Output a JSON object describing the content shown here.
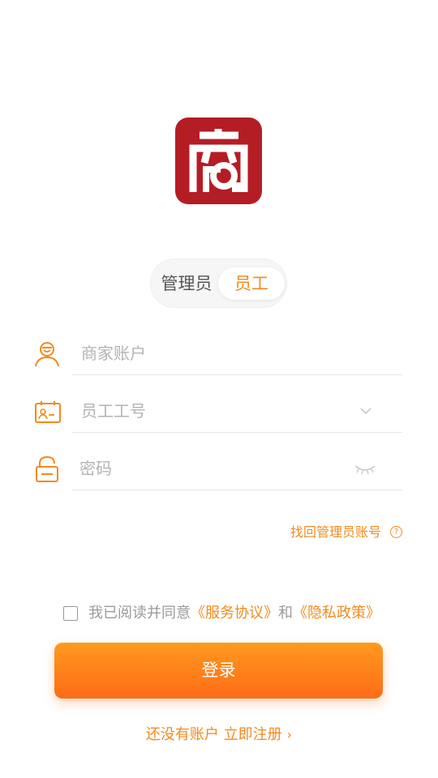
{
  "brand": {
    "logo_char": "商",
    "logo_bg": "#b51d25"
  },
  "role_switch": {
    "admin_label": "管理员",
    "staff_label": "员工",
    "selected": "员工"
  },
  "form": {
    "account": {
      "placeholder": "商家账户",
      "value": "",
      "icon": "user-icon"
    },
    "staff_no": {
      "placeholder": "员工工号",
      "value": "",
      "icon": "id-card-icon",
      "dropdown_icon": "chevron-down-icon"
    },
    "password": {
      "placeholder": "密码",
      "value": "",
      "icon": "lock-icon",
      "toggle_icon": "eye-closed-icon"
    }
  },
  "recover_link": "找回管理员账号",
  "agreement": {
    "prefix": "我已阅读并同意",
    "service": "《服务协议》",
    "and": "和",
    "privacy": "《隐私政策》",
    "checked": false
  },
  "login_button": "登录",
  "register_link": "还没有账户 立即注册",
  "colors": {
    "accent": "#f28a1e",
    "button_top": "#ff9a1f",
    "button_bottom": "#ff6b17"
  }
}
